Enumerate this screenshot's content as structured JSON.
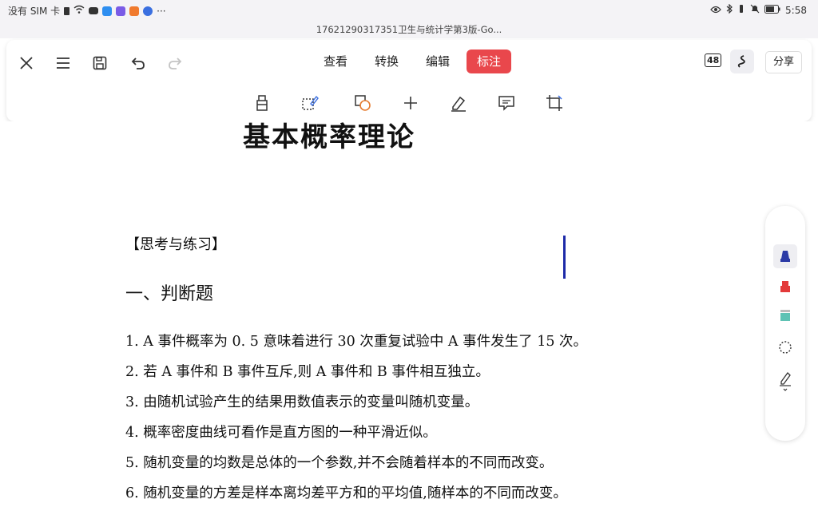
{
  "status_bar": {
    "carrier": "没有 SIM 卡",
    "time": "5:58"
  },
  "file_title": "17621290317351卫生与统计学第3版-Go...",
  "toolbar": {
    "tabs": [
      "查看",
      "转换",
      "编辑",
      "标注"
    ],
    "active_tab": "标注",
    "page_count": "48",
    "share_label": "分享",
    "icons_row1": [
      "close-icon",
      "menu-icon",
      "save-icon",
      "undo-icon",
      "redo-icon"
    ],
    "annotation_tools": [
      "highlighter-icon",
      "area-select-icon",
      "shape-icon",
      "add-icon",
      "pen-icon",
      "comment-icon",
      "crop-icon"
    ]
  },
  "document": {
    "chapter_title": "基本概率理论",
    "section_head": "【思考与练习】",
    "question_head": "一、判断题",
    "questions": [
      "1. A 事件概率为 0. 5 意味着进行 30 次重复试验中 A 事件发生了 15 次。",
      "2. 若 A 事件和 B 事件互斥,则 A 事件和 B 事件相互独立。",
      "3. 由随机试验产生的结果用数值表示的变量叫随机变量。",
      "4. 概率密度曲线可看作是直方图的一种平滑近似。",
      "5. 随机变量的均数是总体的一个参数,并不会随着样本的不同而改变。",
      "6. 随机变量的方差是样本离均差平方和的平均值,随样本的不同而改变。"
    ]
  },
  "palette": {
    "items": [
      "blue-marker-icon",
      "red-marker-icon",
      "teal-highlighter-icon",
      "lasso-icon",
      "handwriting-pen-icon"
    ],
    "colors": {
      "blue": "#2b3aa6",
      "red": "#e33a3a",
      "teal": "#5fc2b4"
    }
  },
  "colors": {
    "accent": "#e9474c",
    "cursor": "#1d2aa8"
  }
}
